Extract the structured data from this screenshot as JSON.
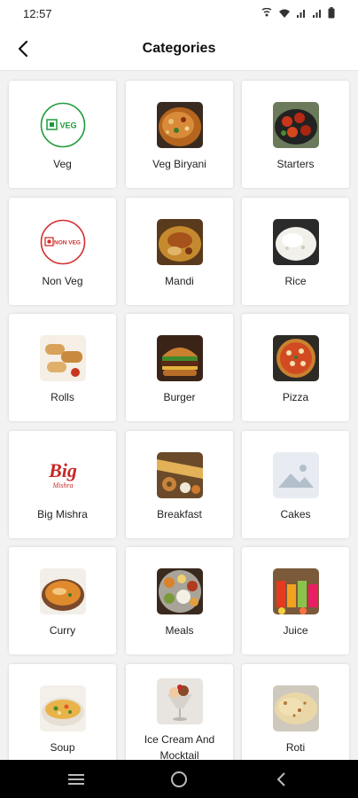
{
  "status_bar": {
    "time": "12:57",
    "icons": [
      "wifi-call-icon",
      "wifi-icon",
      "signal-icon",
      "signal-icon",
      "battery-icon"
    ]
  },
  "header": {
    "title": "Categories",
    "back_icon": "arrow-left-icon"
  },
  "categories": [
    {
      "label": "Veg",
      "icon": "veg-badge-icon"
    },
    {
      "label": "Veg Biryani",
      "icon": "biryani-photo"
    },
    {
      "label": "Starters",
      "icon": "starters-photo"
    },
    {
      "label": "Non Veg",
      "icon": "non-veg-badge-icon"
    },
    {
      "label": "Mandi",
      "icon": "mandi-photo"
    },
    {
      "label": "Rice",
      "icon": "rice-photo"
    },
    {
      "label": "Rolls",
      "icon": "rolls-photo"
    },
    {
      "label": "Burger",
      "icon": "burger-photo"
    },
    {
      "label": "Pizza",
      "icon": "pizza-photo"
    },
    {
      "label": "Big Mishra",
      "icon": "big-mishra-logo",
      "logo_text": "Big",
      "logo_sub": "Mishra"
    },
    {
      "label": "Breakfast",
      "icon": "breakfast-photo"
    },
    {
      "label": "Cakes",
      "icon": "image-placeholder-icon"
    },
    {
      "label": "Curry",
      "icon": "curry-photo"
    },
    {
      "label": "Meals",
      "icon": "meals-photo"
    },
    {
      "label": "Juice",
      "icon": "juice-photo"
    },
    {
      "label": "Soup",
      "icon": "soup-photo"
    },
    {
      "label": "Ice Cream And Mocktail",
      "icon": "ice-cream-photo"
    },
    {
      "label": "Roti",
      "icon": "roti-photo"
    }
  ],
  "badges": {
    "veg": "VEG",
    "non_veg": "NON VEG"
  },
  "colors": {
    "veg_green": "#1e9b3a",
    "non_veg_red": "#d32f2f",
    "nav_bg": "#000000"
  },
  "nav_bar": {
    "icons": [
      "menu-icon",
      "home-icon",
      "back-icon"
    ]
  }
}
